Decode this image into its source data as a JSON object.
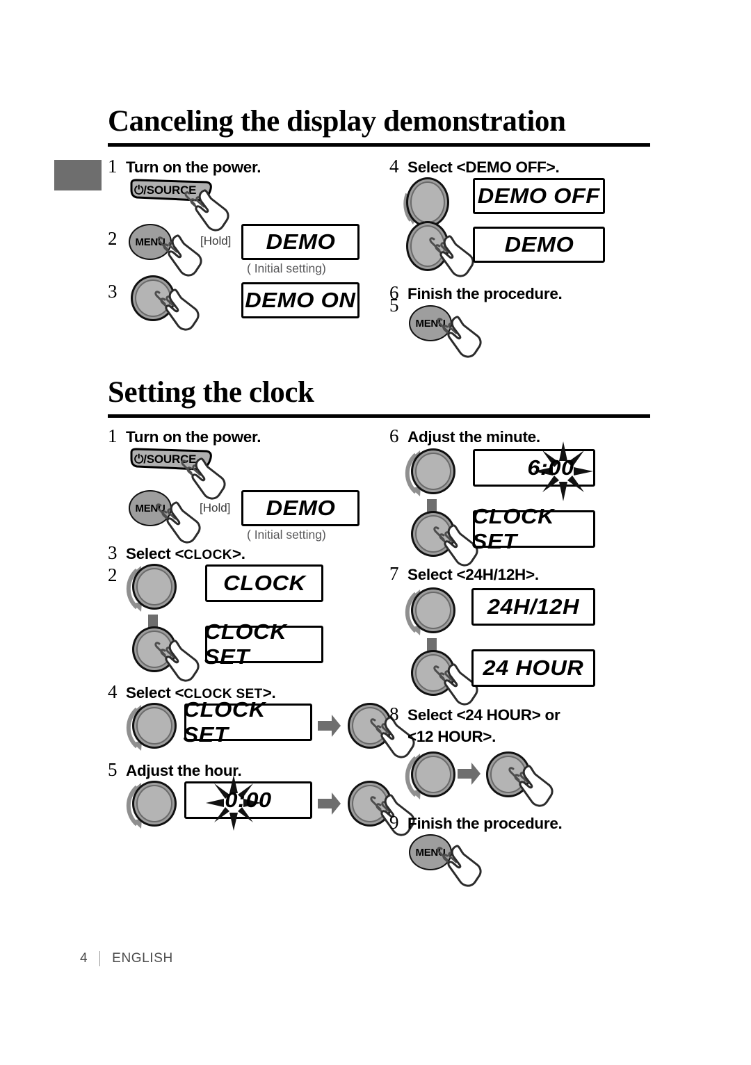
{
  "page": {
    "footer_page_number": "4",
    "footer_language": "ENGLISH",
    "accent_gray": "#6e6e6e",
    "knob_gray": "#9e9e9e",
    "note_gray": "#58585a"
  },
  "sections": [
    {
      "id": "canceling-demo",
      "title": "Canceling the display demonstration",
      "steps": [
        {
          "number": "1",
          "label": "Turn on the power.",
          "control": "power-source-button",
          "control_label": "/SOURCE",
          "power_symbol": "⏻"
        },
        {
          "number": "2",
          "label": "",
          "control": "menu-button",
          "control_label": "MENU",
          "hold_note": "[Hold]",
          "display": "DEMO",
          "display_note": "( Initial setting)"
        },
        {
          "number": "3",
          "label": "",
          "control": "knob-press",
          "display": "DEMO ON"
        },
        {
          "number": "4",
          "label": "Select <DEMO OFF>.",
          "control": "knob-turn",
          "display": "DEMO OFF"
        },
        {
          "number": "5",
          "label": "",
          "control": "knob-press",
          "display": "DEMO"
        },
        {
          "number": "6",
          "label": "Finish the procedure.",
          "control": "menu-button",
          "control_label": "MENU"
        }
      ]
    },
    {
      "id": "setting-clock",
      "title": "Setting the clock",
      "steps": [
        {
          "number": "1",
          "label": "Turn on the power.",
          "control": "power-source-button",
          "control_label": "/SOURCE",
          "power_symbol": "⏻"
        },
        {
          "number": "2",
          "label": "",
          "control": "menu-button",
          "control_label": "MENU",
          "hold_note": "[Hold]",
          "display": "DEMO",
          "display_note": "( Initial setting)"
        },
        {
          "number": "3",
          "label_pre": "Select <",
          "label_caps": "CLOCK",
          "label_post": ">.",
          "control": "knob-turn-then-press",
          "display_1": "CLOCK",
          "display_2": "CLOCK SET"
        },
        {
          "number": "4",
          "label_pre": "Select <",
          "label_caps": "CLOCK SET",
          "label_post": ">.",
          "control": "knob-turn-arrow-press",
          "display_1": "CLOCK SET"
        },
        {
          "number": "5",
          "label": "Adjust the hour.",
          "control": "knob-turn-arrow-press",
          "display_1": "0:00",
          "flash": "hour"
        },
        {
          "number": "6",
          "label": "Adjust the minute.",
          "control": "knob-turn-then-press",
          "display_1": "6:00",
          "display_2": "CLOCK SET",
          "flash": "minute"
        },
        {
          "number": "7",
          "label": "Select <24H/12H>.",
          "control": "knob-turn-then-press",
          "display_1": "24H/12H",
          "display_2": "24 HOUR"
        },
        {
          "number": "8",
          "label_line1": "Select <24 HOUR> or",
          "label_line2": "<12 HOUR>.",
          "control": "knob-turn-arrow-press"
        },
        {
          "number": "9",
          "label": "Finish the procedure.",
          "control": "menu-button",
          "control_label": "MENU"
        }
      ]
    }
  ]
}
